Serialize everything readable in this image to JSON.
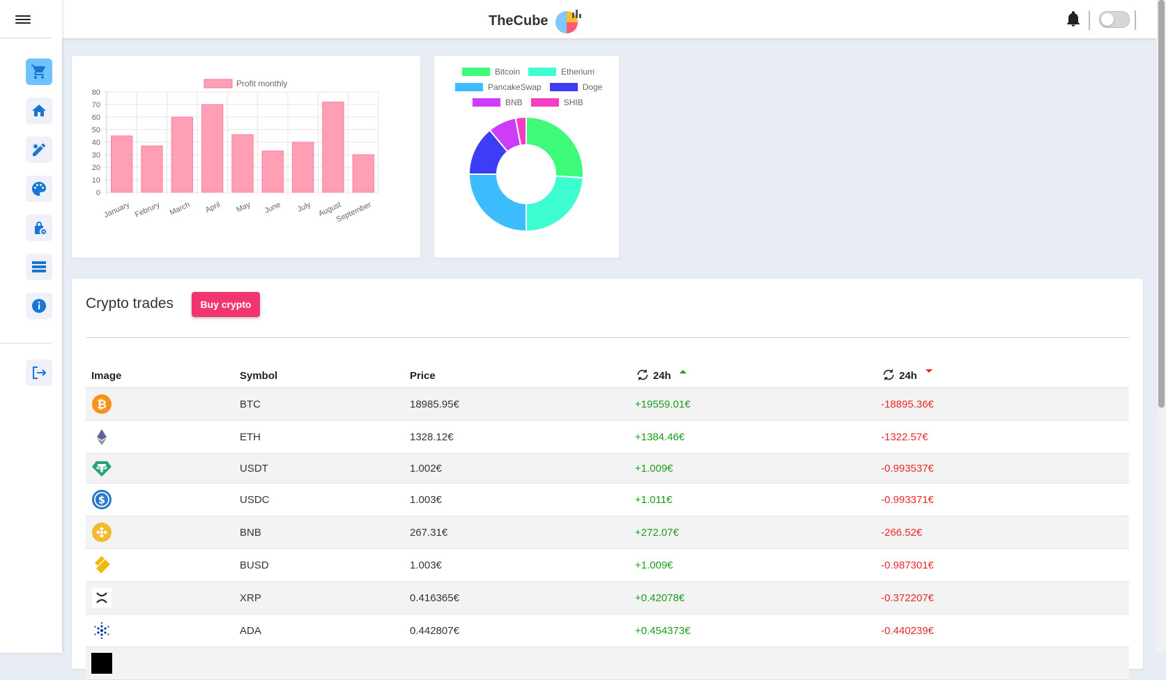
{
  "header": {
    "brand": "TheCube"
  },
  "sidebar": {
    "items": [
      {
        "icon": "cart-icon"
      },
      {
        "icon": "home-icon"
      },
      {
        "icon": "edit-icon"
      },
      {
        "icon": "palette-icon"
      },
      {
        "icon": "lock-icon"
      },
      {
        "icon": "list-icon"
      },
      {
        "icon": "info-icon"
      }
    ],
    "logout_icon": "logout-icon"
  },
  "colors": {
    "accent": "#f2356d",
    "active_sidebar": "#6fc2ff",
    "positive": "#1a9c1a",
    "negative": "#e82828",
    "bar": "#ff9fb5"
  },
  "chart_data": [
    {
      "type": "bar",
      "legend": "Profit monthly",
      "categories": [
        "January",
        "Februry",
        "March",
        "April",
        "May",
        "June",
        "July",
        "August",
        "September"
      ],
      "values": [
        45,
        37,
        60,
        70,
        46,
        33,
        40,
        72,
        30
      ],
      "ylim": [
        0,
        80
      ],
      "yticks": [
        0,
        10,
        20,
        30,
        40,
        50,
        60,
        70,
        80
      ],
      "grid": true,
      "legend_position": "top"
    },
    {
      "type": "pie",
      "style": "doughnut",
      "labels": [
        "Bitcoin",
        "Etherium",
        "PancakeSwap",
        "Doge",
        "BNB",
        "SHIB"
      ],
      "values": [
        26,
        24,
        25,
        14,
        8,
        3
      ],
      "colors": [
        "#3dfb79",
        "#3dfdd1",
        "#3dbcfd",
        "#3d3df6",
        "#cd3df9",
        "#f33dc3"
      ],
      "legend_position": "top"
    }
  ],
  "trades": {
    "title": "Crypto trades",
    "buy_label": "Buy crypto",
    "columns": [
      "Image",
      "Symbol",
      "Price",
      "24h",
      "24h"
    ],
    "rows": [
      {
        "symbol": "BTC",
        "price": "18985.95€",
        "up": "+19559.01€",
        "down": "-18895.36€",
        "icon": "bitcoin-icon"
      },
      {
        "symbol": "ETH",
        "price": "1328.12€",
        "up": "+1384.46€",
        "down": "-1322.57€",
        "icon": "ethereum-icon"
      },
      {
        "symbol": "USDT",
        "price": "1.002€",
        "up": "+1.009€",
        "down": "-0.993537€",
        "icon": "tether-icon"
      },
      {
        "symbol": "USDC",
        "price": "1.003€",
        "up": "+1.011€",
        "down": "-0.993371€",
        "icon": "usdc-icon"
      },
      {
        "symbol": "BNB",
        "price": "267.31€",
        "up": "+272.07€",
        "down": "-266.52€",
        "icon": "bnb-icon"
      },
      {
        "symbol": "BUSD",
        "price": "1.003€",
        "up": "+1.009€",
        "down": "-0.987301€",
        "icon": "busd-icon"
      },
      {
        "symbol": "XRP",
        "price": "0.416365€",
        "up": "+0.42078€",
        "down": "-0.372207€",
        "icon": "xrp-icon"
      },
      {
        "symbol": "ADA",
        "price": "0.442807€",
        "up": "+0.454373€",
        "down": "-0.440239€",
        "icon": "cardano-icon"
      }
    ]
  }
}
